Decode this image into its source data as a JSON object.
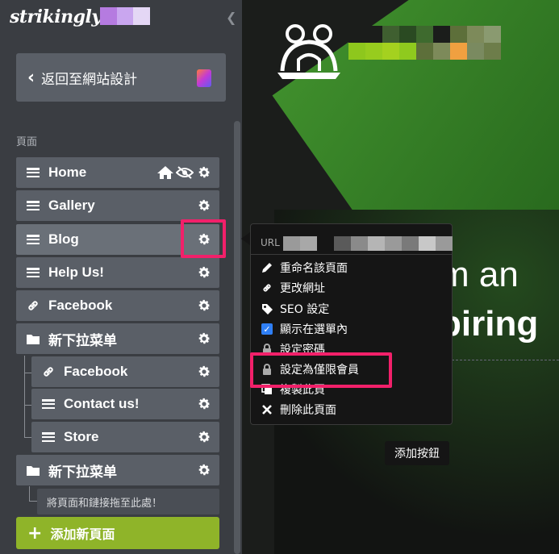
{
  "sidebar": {
    "logo_text": "strikingly",
    "logo_blocks": [
      "#b57be0",
      "#c9a6ef",
      "#e4d7f5"
    ],
    "back_label": "返回至網站設計",
    "section_label": "頁面",
    "pages": [
      {
        "label": "Home",
        "icon": "hamburger-icon"
      },
      {
        "label": "Gallery",
        "icon": "hamburger-icon"
      },
      {
        "label": "Blog",
        "icon": "hamburger-icon"
      },
      {
        "label": "Help Us!",
        "icon": "hamburger-icon"
      },
      {
        "label": "Facebook",
        "icon": "link-icon"
      },
      {
        "label": "新下拉菜单",
        "icon": "folder-icon"
      },
      {
        "label": "Facebook",
        "icon": "link-icon"
      },
      {
        "label": "Contact us!",
        "icon": "hamburger-icon"
      },
      {
        "label": "Store",
        "icon": "hamburger-icon"
      },
      {
        "label": "新下拉菜单",
        "icon": "folder-icon"
      }
    ],
    "drop_hint": "將頁面和鏈接拖至此處！",
    "add_page_label": "添加新頁面",
    "accent_color": "#8fb429",
    "highlight_color": "#f2206a"
  },
  "preview": {
    "hero_line1": "m an",
    "hero_line2": "piring",
    "add_button_label": "添加按鈕",
    "brand_blocks": [
      [
        "#1b1d1b",
        "#1b1d1b",
        "#3f5f30",
        "#2a4a22",
        "#3e6a2e",
        "#1b1d1b",
        "#5d6f3a",
        "#7d8a5a",
        "#8a9a70"
      ],
      [
        "#8ec71d",
        "#97cc1e",
        "#a4d11f",
        "#8fca1e",
        "#5d6f3a",
        "#7d8a5a",
        "#f0a040",
        "#7a8a60",
        "#6d7d4a"
      ]
    ]
  },
  "menu": {
    "url_label": "URL",
    "url_blocks": [
      "#9a9a9a",
      "#a8a8a8",
      "#151515",
      "#5a5a5a",
      "#8a8a8a",
      "#b5b5b5",
      "#9a9a9a",
      "#7a7a7a",
      "#c8c8c8",
      "#9a9a9a"
    ],
    "items": [
      {
        "label": "重命名該頁面",
        "icon": "pencil-icon"
      },
      {
        "label": "更改網址",
        "icon": "link-icon"
      },
      {
        "label": "SEO 設定",
        "icon": "tag-icon"
      },
      {
        "label": "顯示在選單內",
        "icon": "checkbox-icon"
      },
      {
        "label": "設定密碼",
        "icon": "lock-icon"
      },
      {
        "label": "設定為僅限會員",
        "icon": "lock-icon"
      },
      {
        "label": "複製此頁",
        "icon": "copy-icon"
      },
      {
        "label": "刪除此頁面",
        "icon": "close-icon"
      }
    ]
  }
}
